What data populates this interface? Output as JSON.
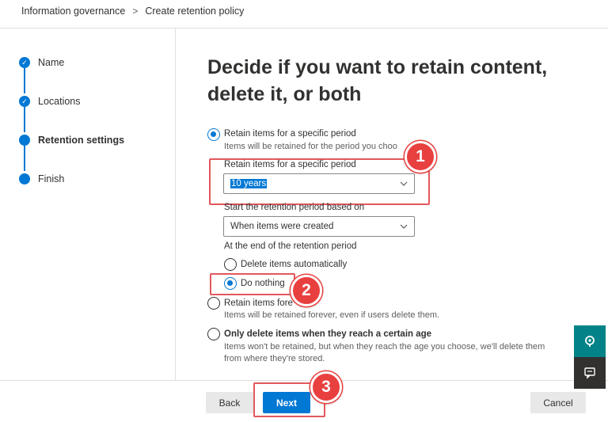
{
  "breadcrumb": {
    "items": [
      "Information governance",
      "Create retention policy"
    ],
    "separator": ">"
  },
  "wizard": {
    "steps": [
      {
        "label": "Name",
        "status": "completed"
      },
      {
        "label": "Locations",
        "status": "completed"
      },
      {
        "label": "Retention settings",
        "status": "current"
      },
      {
        "label": "Finish",
        "status": "pending"
      }
    ]
  },
  "main": {
    "heading": "Decide if you want to retain content, delete it, or both",
    "option_retain": {
      "label": "Retain items for a specific period",
      "description": "Items will be retained for the period you choo",
      "selected": true
    },
    "retention_period": {
      "label": "Retain items for a specific period",
      "value": "10 years"
    },
    "start_based_on": {
      "label": "Start the retention period based on",
      "value": "When items were created"
    },
    "end_action": {
      "label": "At the end of the retention period",
      "options": [
        {
          "label": "Delete items automatically",
          "selected": false
        },
        {
          "label": "Do nothing",
          "selected": true
        }
      ]
    },
    "option_forever": {
      "label": "Retain items fore",
      "description": "Items will be retained forever, even if users delete them.",
      "selected": false
    },
    "option_delete_only": {
      "label": "Only delete items when they reach a certain age",
      "description_line1": "Items won't be retained, but when they reach the age you choose, we'll delete them",
      "description_line2": "from where they're stored.",
      "selected": false
    }
  },
  "footer": {
    "back_label": "Back",
    "next_label": "Next",
    "cancel_label": "Cancel"
  },
  "annotations": {
    "badge_1": "1",
    "badge_2": "2",
    "badge_3": "3"
  },
  "side_panel": {
    "top_icon": "support-icon",
    "bottom_icon": "feedback-icon",
    "top_color": "#038387",
    "bottom_color": "#323130"
  },
  "colors": {
    "accent": "#0078d4",
    "annotation_red": "#e8403f",
    "highlight_border": "#e2585d"
  }
}
